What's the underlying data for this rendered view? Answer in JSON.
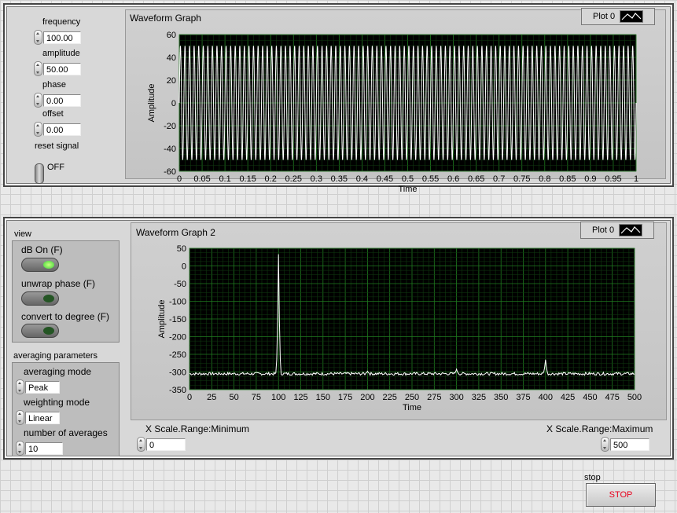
{
  "controls": {
    "frequency": {
      "label": "frequency",
      "value": "100.00"
    },
    "amplitude": {
      "label": "amplitude",
      "value": "50.00"
    },
    "phase": {
      "label": "phase",
      "value": "0.00"
    },
    "offset": {
      "label": "offset",
      "value": "0.00"
    },
    "reset_signal": {
      "label": "reset signal",
      "state": "OFF"
    }
  },
  "graph1": {
    "title": "Waveform Graph",
    "legend": "Plot 0",
    "xlabel": "Time",
    "ylabel": "Amplitude",
    "chart_data": {
      "type": "line",
      "title": "Waveform Graph",
      "xlabel": "Time",
      "ylabel": "Amplitude",
      "xlim": [
        0,
        1
      ],
      "ylim": [
        -60,
        60
      ],
      "xticks": [
        "0",
        "0.05",
        "0.1",
        "0.15",
        "0.2",
        "0.25",
        "0.3",
        "0.35",
        "0.4",
        "0.45",
        "0.5",
        "0.55",
        "0.6",
        "0.65",
        "0.7",
        "0.75",
        "0.8",
        "0.85",
        "0.9",
        "0.95",
        "1"
      ],
      "yticks": [
        "60",
        "40",
        "20",
        "0",
        "-20",
        "-40",
        "-60"
      ],
      "series": [
        {
          "name": "Plot 0",
          "frequency": 100,
          "amplitude": 50,
          "phase": 0,
          "offset": 0
        }
      ],
      "grid": true,
      "colors": {
        "background": "#000000",
        "grid": "#1f7a1f",
        "line": "#ffffff"
      }
    }
  },
  "view": {
    "label": "view",
    "db_on": {
      "label": "dB On (F)",
      "state": true
    },
    "unwrap_phase": {
      "label": "unwrap phase (F)",
      "state": false
    },
    "convert_degree": {
      "label": "convert to degree (F)",
      "state": false
    }
  },
  "averaging": {
    "label": "averaging parameters",
    "mode": {
      "label": "averaging mode",
      "value": "Peak"
    },
    "weighting": {
      "label": "weighting mode",
      "value": "Linear"
    },
    "number": {
      "label": "number of averages",
      "value": "10"
    }
  },
  "graph2": {
    "title": "Waveform Graph 2",
    "legend": "Plot 0",
    "xlabel": "Time",
    "ylabel": "Amplitude",
    "chart_data": {
      "type": "line",
      "title": "Waveform Graph 2",
      "xlabel": "Time",
      "ylabel": "Amplitude",
      "xlim": [
        0,
        500
      ],
      "ylim": [
        -350,
        50
      ],
      "xticks": [
        "0",
        "25",
        "50",
        "75",
        "100",
        "125",
        "150",
        "175",
        "200",
        "225",
        "250",
        "275",
        "300",
        "325",
        "350",
        "375",
        "400",
        "425",
        "450",
        "475",
        "500"
      ],
      "yticks": [
        "50",
        "0",
        "-50",
        "-100",
        "-150",
        "-200",
        "-250",
        "-300",
        "-350"
      ],
      "series": [
        {
          "name": "Plot 0",
          "baseline": -305,
          "peaks": [
            {
              "x": 100,
              "y": 33
            },
            {
              "x": 200,
              "y": -298
            },
            {
              "x": 300,
              "y": -292
            },
            {
              "x": 400,
              "y": -265
            }
          ]
        }
      ],
      "grid": true,
      "colors": {
        "background": "#000000",
        "grid": "#1f7a1f",
        "line": "#ffffff"
      }
    }
  },
  "xscale": {
    "min": {
      "label": "X Scale.Range:Minimum",
      "value": "0"
    },
    "max": {
      "label": "X Scale.Range:Maximum",
      "value": "500"
    }
  },
  "stop": {
    "label": "stop",
    "button": "STOP"
  }
}
